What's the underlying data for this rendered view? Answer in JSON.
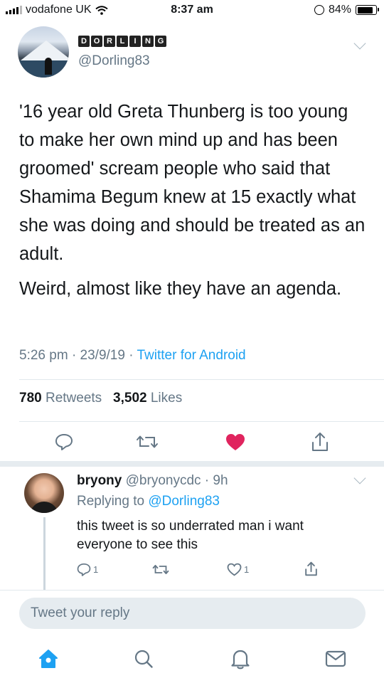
{
  "status_bar": {
    "carrier": "vodafone UK",
    "time": "8:37 am",
    "battery_percent": "84%",
    "battery_level": 0.84
  },
  "tweet": {
    "brand_letters": [
      "D",
      "O",
      "R",
      "L",
      "I",
      "N",
      "G"
    ],
    "handle": "@Dorling83",
    "paragraph_1": "'16 year old Greta Thunberg is too young to make her own mind up and has been groomed' scream people who said that Shamima Begum knew at 15 exactly what she was doing and should be treated as an adult.",
    "paragraph_2": "Weird, almost like they have an agenda.",
    "time": "5:26 pm",
    "date": "23/9/19",
    "source": "Twitter for Android",
    "retweets_count": "780",
    "retweets_label": "Retweets",
    "likes_count": "3,502",
    "likes_label": "Likes",
    "liked": true
  },
  "reply": {
    "name": "bryony",
    "handle": "@bryonycdc",
    "age": "9h",
    "replying_label": "Replying to",
    "replying_to": "@Dorling83",
    "text": "this tweet is so underrated man i want everyone to see this",
    "reply_count": "1",
    "like_count": "1"
  },
  "compose": {
    "placeholder": "Tweet your reply"
  },
  "nav": {
    "icons": [
      "home-icon",
      "search-icon",
      "notifications-icon",
      "messages-icon"
    ],
    "accent": "#1da1f2"
  },
  "colors": {
    "accent": "#1da1f2",
    "like": "#e0245e",
    "secondary_text": "#657786"
  }
}
